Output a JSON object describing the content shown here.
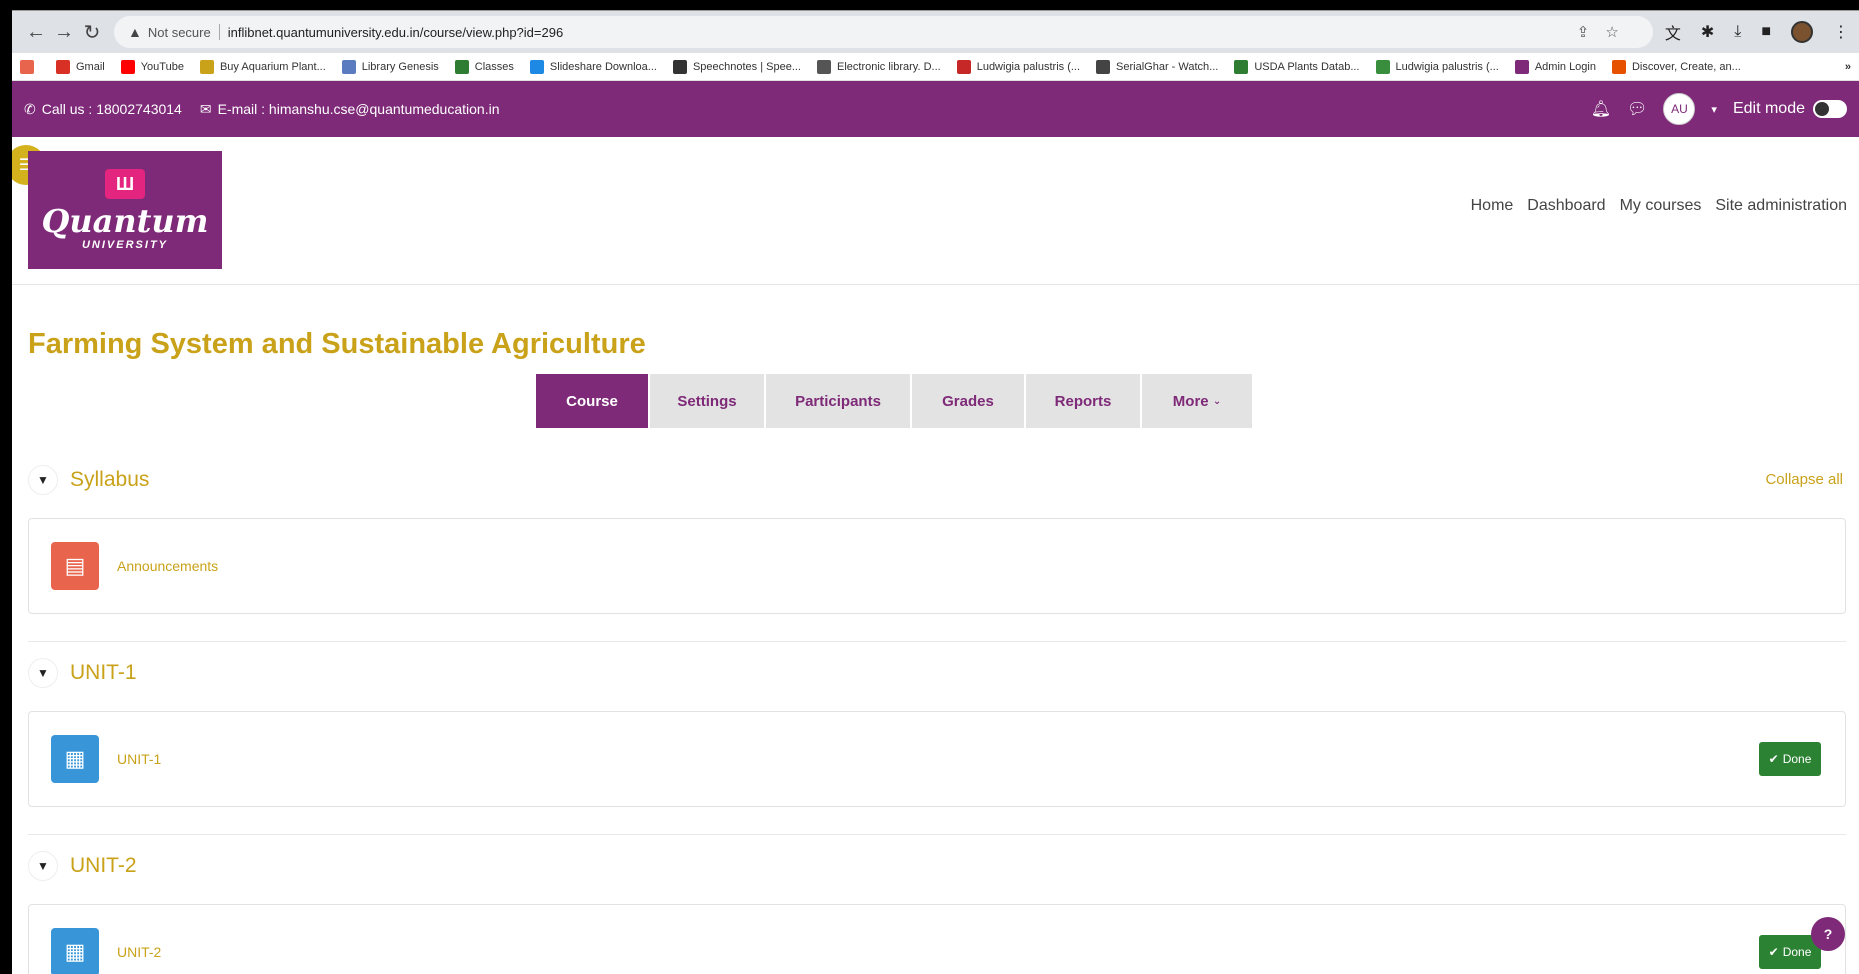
{
  "browser": {
    "security_label": "Not secure",
    "url": "inflibnet.quantumuniversity.edu.in/course/view.php?id=296",
    "bookmarks": [
      {
        "label": "Gmail",
        "color": "#d93025"
      },
      {
        "label": "YouTube",
        "color": "#ff0000"
      },
      {
        "label": "Buy Aquarium Plant...",
        "color": "#c9a21a"
      },
      {
        "label": "Library Genesis",
        "color": "#5a7bbf"
      },
      {
        "label": "Classes",
        "color": "#2e7d32"
      },
      {
        "label": "Slideshare Downloa...",
        "color": "#1e88e5"
      },
      {
        "label": "Speechnotes | Spee...",
        "color": "#333333"
      },
      {
        "label": "Electronic library. D...",
        "color": "#555555"
      },
      {
        "label": "Ludwigia palustris (...",
        "color": "#c62828"
      },
      {
        "label": "SerialGhar - Watch...",
        "color": "#444444"
      },
      {
        "label": "USDA Plants Datab...",
        "color": "#2e7d32"
      },
      {
        "label": "Ludwigia palustris (...",
        "color": "#388e3c"
      },
      {
        "label": "Admin Login",
        "color": "#7e2a78"
      },
      {
        "label": "Discover, Create, an...",
        "color": "#e65100"
      }
    ],
    "bookmarks_more": "»"
  },
  "topbar": {
    "call_label": "Call us : 18002743014",
    "email_label": "E-mail : himanshu.cse@quantumeducation.in",
    "avatar_initials": "AU",
    "edit_mode_label": "Edit mode"
  },
  "logo": {
    "word": "Quantum",
    "sub": "UNIVERSITY"
  },
  "main_nav": [
    "Home",
    "Dashboard",
    "My courses",
    "Site administration"
  ],
  "course": {
    "title": "Farming System and Sustainable Agriculture",
    "tabs": [
      "Course",
      "Settings",
      "Participants",
      "Grades",
      "Reports",
      "More"
    ],
    "collapse_all": "Collapse all",
    "sections": [
      {
        "name": "Syllabus",
        "activity": "Announcements"
      },
      {
        "name": "UNIT-1",
        "activity": "UNIT-1",
        "done": "Done"
      },
      {
        "name": "UNIT-2",
        "activity": "UNIT-2",
        "done": "Done"
      }
    ]
  },
  "colors": {
    "brand_purple": "#7e2a78",
    "accent_gold": "#c9a21a",
    "done_green": "#2c8233"
  }
}
